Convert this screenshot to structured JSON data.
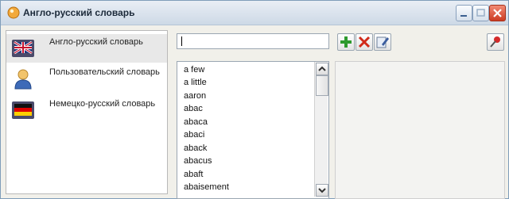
{
  "window": {
    "title": "Англо-русский словарь",
    "icon": "dictionary-app-icon",
    "controls": [
      "minimize-icon",
      "maximize-icon",
      "close-icon"
    ]
  },
  "sidebar": {
    "items": [
      {
        "label": "Англо-русский словарь",
        "icon": "uk-flag-book-icon",
        "selected": true
      },
      {
        "label": "Пользовательский словарь",
        "icon": "user-icon",
        "selected": false
      },
      {
        "label": "Немецко-русский словарь",
        "icon": "german-flag-book-icon",
        "selected": false
      }
    ]
  },
  "search": {
    "value": ""
  },
  "toolbar": {
    "buttons": [
      "add-icon",
      "delete-icon",
      "edit-icon"
    ],
    "pin": "pin-icon"
  },
  "word_list": {
    "items": [
      "a few",
      "a little",
      "aaron",
      "abac",
      "abaca",
      "abaci",
      "aback",
      "abacus",
      "abaft",
      "abaisement"
    ]
  },
  "colors": {
    "add": "#2e9a2e",
    "delete": "#d12a1a",
    "close": "#cc3b22",
    "selected_row": "#e8e8e8"
  }
}
